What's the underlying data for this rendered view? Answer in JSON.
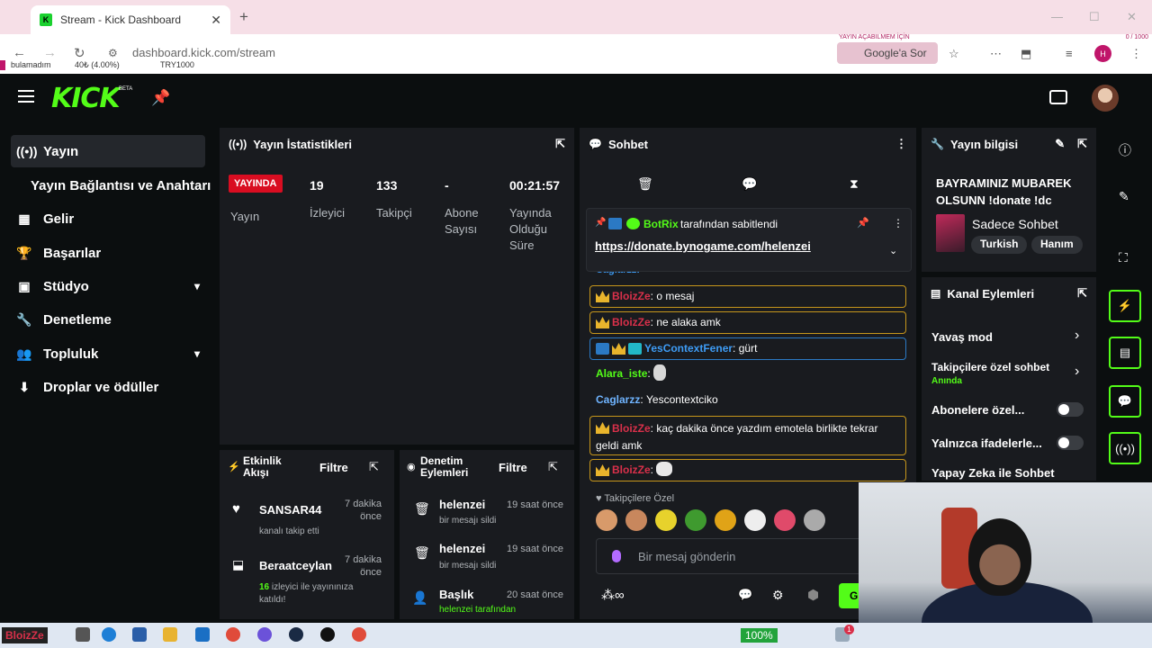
{
  "browser": {
    "tab_title": "Stream - Kick Dashboard",
    "url": "dashboard.kick.com/stream",
    "google_button": "Google'a Sor",
    "bookmark_1": "bulamadım",
    "bookmark_2": "40₺ (4.00%)",
    "bookmark_3": "TRY1000",
    "overlay_left": "YAYIN AÇABILMEM İÇİN",
    "overlay_right": "0 / 1000"
  },
  "app": {
    "logo": "KICK",
    "beta": "BETA"
  },
  "sidebar": {
    "items": [
      {
        "label": "Yayın",
        "icon": "broadcast-icon"
      },
      {
        "label": "Yayın Bağlantısı ve Anahtarı",
        "icon": ""
      },
      {
        "label": "Gelir",
        "icon": "chart-icon"
      },
      {
        "label": "Başarılar",
        "icon": "trophy-icon"
      },
      {
        "label": "Stüdyo",
        "icon": "studio-icon"
      },
      {
        "label": "Denetleme",
        "icon": "wrench-icon"
      },
      {
        "label": "Topluluk",
        "icon": "people-icon"
      },
      {
        "label": "Droplar ve ödüller",
        "icon": "gift-icon"
      }
    ]
  },
  "stats": {
    "title": "Yayın İstatistikleri",
    "live_badge": "YAYINDA",
    "viewers": "19",
    "followers": "133",
    "subs": "-",
    "uptime": "00:21:57",
    "label_stream": "Yayın",
    "label_viewers": "İzleyici",
    "label_followers": "Takipçi",
    "label_subs_1": "Abone",
    "label_subs_2": "Sayısı",
    "label_uptime_1": "Yayında",
    "label_uptime_2": "Olduğu",
    "label_uptime_3": "Süre"
  },
  "activity": {
    "title_1": "Etkinlik",
    "title_2": "Akışı",
    "filter": "Filtre",
    "events": [
      {
        "user": "SANSAR44",
        "desc": "kanalı takip etti",
        "time_1": "7 dakika",
        "time_2": "önce"
      },
      {
        "user": "Beraatceylan",
        "desc_count": "16",
        "desc": "izleyici ile yayınınıza",
        "desc_2": "katıldı!",
        "time_1": "7 dakika",
        "time_2": "önce"
      }
    ]
  },
  "moderation": {
    "title_1": "Denetim",
    "title_2": "Eylemleri",
    "filter": "Filtre",
    "items": [
      {
        "user": "helenzei",
        "time": "19 saat önce",
        "desc": "bir mesajı sildi"
      },
      {
        "user": "helenzei",
        "time": "19 saat önce",
        "desc": "bir mesajı sildi"
      },
      {
        "user": "Başlık",
        "time": "20 saat önce",
        "desc": "helenzei tarafından"
      }
    ]
  },
  "chat": {
    "title": "Sohbet",
    "pinned_by_user": "BotRix",
    "pinned_by_text": "tarafından sabitlendi",
    "pinned_link": "https://donate.bynogame.com/helenzei",
    "partial_user": "Caglarzz:",
    "messages": [
      {
        "user": "BloizZe",
        "text": "o mesaj",
        "style": "gold"
      },
      {
        "user": "BloizZe",
        "text": "ne alaka amk",
        "style": "gold"
      },
      {
        "user": "YesContextFener",
        "text": "gürt",
        "style": "blue"
      },
      {
        "user": "Alara_iste",
        "text": "",
        "style": "plain"
      },
      {
        "user": "Caglarzz",
        "text": "Yescontextciko",
        "style": "plain"
      },
      {
        "user": "BloizZe",
        "text": "kaç dakika önce yazdım emotela birlikte tekrar geldi amk",
        "style": "gold"
      },
      {
        "user": "BloizZe",
        "text": "",
        "style": "gold"
      }
    ],
    "mode_label": "Takipçilere Özel",
    "input_placeholder": "Bir mesaj gönderin",
    "send_label": "G"
  },
  "info": {
    "title": "Yayın bilgisi",
    "stream_title": "BAYRAMINIZ MUBAREK OLSUNN !donate !dc",
    "category": "Sadece Sohbet",
    "tags": [
      "Turkish",
      "Hanım"
    ]
  },
  "actions": {
    "title": "Kanal Eylemleri",
    "slow_mode": "Yavaş mod",
    "followers_only": "Takipçilere özel sohbet",
    "followers_only_sub": "Anında",
    "subs_only": "Abonelere özel...",
    "emotes_only": "Yalnızca ifadelerle...",
    "ai": "Yapay Zeka ile Sohbet Denetimi"
  },
  "taskbar": {
    "app_label": "BloizZe",
    "zoom": "100%",
    "notif_count": "1"
  },
  "colors": {
    "accent": "#53fc18",
    "live": "#d90d21",
    "panel": "#191b1f",
    "background": "#0b0e0f"
  }
}
